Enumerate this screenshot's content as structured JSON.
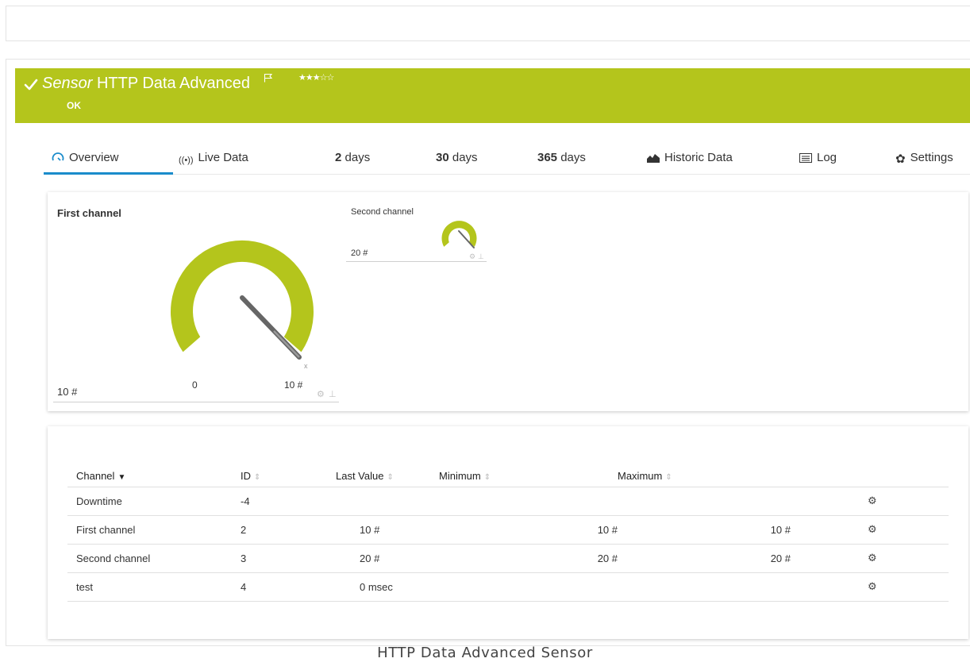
{
  "header": {
    "sensor_kind": "Sensor",
    "sensor_name": "HTTP Data Advanced",
    "stars": "★★★☆☆",
    "status": "OK",
    "color": "#b4c51c"
  },
  "tabs": [
    {
      "label": "Overview",
      "icon": "gauge-icon"
    },
    {
      "label": "Live Data",
      "icon": "live-data-icon"
    },
    {
      "bold": "2",
      "label": " days"
    },
    {
      "bold": "30",
      "label": " days"
    },
    {
      "bold": "365",
      "label": " days"
    },
    {
      "label": "Historic Data",
      "icon": "area-chart-icon"
    },
    {
      "label": "Log",
      "icon": "log-icon"
    },
    {
      "label": "Settings",
      "icon": "gear-icon"
    }
  ],
  "gauges": {
    "first": {
      "title": "First channel",
      "value": "10 #",
      "min_label": "0",
      "max_label": "10 #"
    },
    "second": {
      "title": "Second channel",
      "value": "20 #"
    }
  },
  "table": {
    "headers": [
      "Channel",
      "ID",
      "Last Value",
      "Minimum",
      "Maximum"
    ],
    "rows": [
      {
        "channel": "Downtime",
        "id": "-4",
        "last": "",
        "min": "",
        "max": ""
      },
      {
        "channel": "First channel",
        "id": "2",
        "last": "10 #",
        "min": "10 #",
        "max": "10 #"
      },
      {
        "channel": "Second channel",
        "id": "3",
        "last": "20 #",
        "min": "20 #",
        "max": "20 #"
      },
      {
        "channel": "test",
        "id": "4",
        "last": "0 msec",
        "min": "",
        "max": ""
      }
    ]
  },
  "caption": "HTTP Data Advanced Sensor"
}
